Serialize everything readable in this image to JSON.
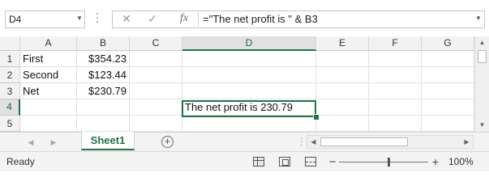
{
  "namebox": {
    "value": "D4"
  },
  "formula_bar": {
    "cancel_icon": "✕",
    "enter_icon": "✓",
    "function_icon": "fx",
    "formula": "=\"The net profit is \" & B3"
  },
  "grid": {
    "columns": [
      "A",
      "B",
      "C",
      "D",
      "E",
      "F",
      "G"
    ],
    "rows": [
      "1",
      "2",
      "3",
      "4",
      "5"
    ],
    "active_cell": "D4",
    "cells": {
      "A1": "First",
      "B1": "$354.23",
      "A2": "Second",
      "B2": "$123.44",
      "A3": "Net",
      "B3": "$230.79",
      "D4": "The net profit is 230.79"
    }
  },
  "sheet_tabs": {
    "tabs": [
      "Sheet1"
    ],
    "add_sheet_icon": "+"
  },
  "status_bar": {
    "status": "Ready",
    "zoom_minus": "−",
    "zoom_plus": "+",
    "zoom_level": "100%",
    "zoom_percent": 100
  },
  "colors": {
    "accent": "#217346",
    "header_bg": "#f2f2f2",
    "gridline": "#e1e1e1"
  }
}
